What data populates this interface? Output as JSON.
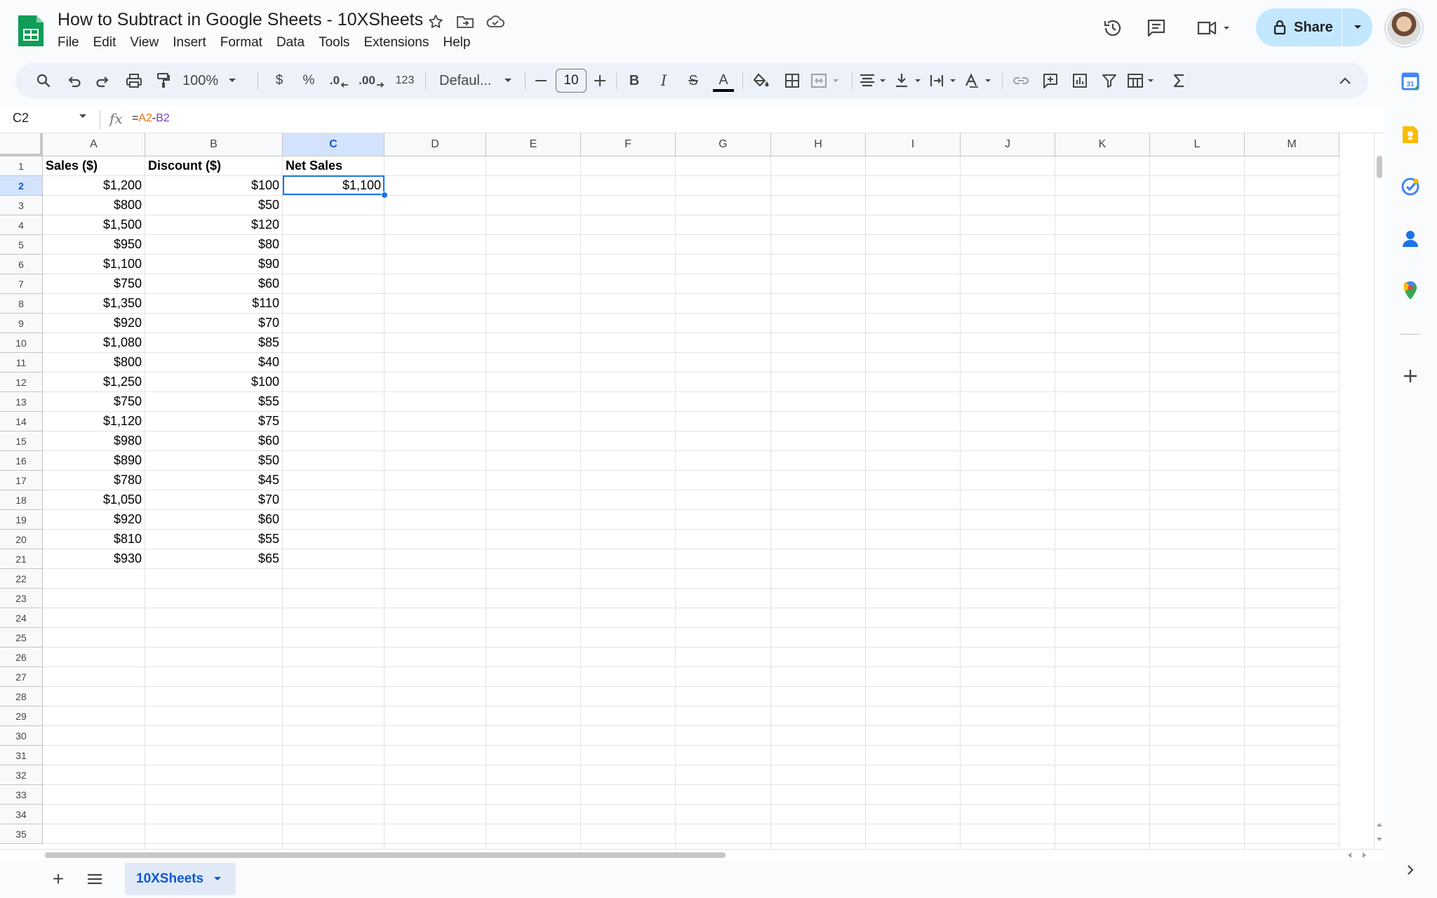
{
  "app": {
    "doc_title": "How to Subtract in Google Sheets - 10XSheets",
    "share_label": "Share"
  },
  "menu": [
    "File",
    "Edit",
    "View",
    "Insert",
    "Format",
    "Data",
    "Tools",
    "Extensions",
    "Help"
  ],
  "toolbar": {
    "zoom": "100%",
    "currency": "$",
    "percent": "%",
    "decrease_decimal": ".0",
    "increase_decimal": ".00",
    "number_format": "123",
    "font": "Defaul...",
    "font_size": "10",
    "bold": "B",
    "italic": "I",
    "strike": "S",
    "text_color": "A"
  },
  "formula_bar": {
    "name_box": "C2",
    "formula_prefix": "=",
    "formula_ref1": "A2",
    "formula_op": "-",
    "formula_ref2": "B2"
  },
  "columns": [
    "A",
    "B",
    "C",
    "D",
    "E",
    "F",
    "G",
    "H",
    "I",
    "J",
    "K",
    "L",
    "M"
  ],
  "selected_column": "C",
  "selected_row": 2,
  "row_count": 35,
  "table": {
    "headers": [
      "Sales ($)",
      "Discount ($)",
      "Net Sales"
    ],
    "rows": [
      [
        "$1,200",
        "$100",
        "$1,100"
      ],
      [
        "$800",
        "$50",
        ""
      ],
      [
        "$1,500",
        "$120",
        ""
      ],
      [
        "$950",
        "$80",
        ""
      ],
      [
        "$1,100",
        "$90",
        ""
      ],
      [
        "$750",
        "$60",
        ""
      ],
      [
        "$1,350",
        "$110",
        ""
      ],
      [
        "$920",
        "$70",
        ""
      ],
      [
        "$1,080",
        "$85",
        ""
      ],
      [
        "$800",
        "$40",
        ""
      ],
      [
        "$1,250",
        "$100",
        ""
      ],
      [
        "$750",
        "$55",
        ""
      ],
      [
        "$1,120",
        "$75",
        ""
      ],
      [
        "$980",
        "$60",
        ""
      ],
      [
        "$890",
        "$50",
        ""
      ],
      [
        "$780",
        "$45",
        ""
      ],
      [
        "$1,050",
        "$70",
        ""
      ],
      [
        "$920",
        "$60",
        ""
      ],
      [
        "$810",
        "$55",
        ""
      ],
      [
        "$930",
        "$65",
        ""
      ]
    ]
  },
  "sheet_tab": "10XSheets",
  "icons": {
    "title": [
      "star-icon",
      "move-folder-icon",
      "cloud-status-icon"
    ],
    "top_right": [
      "version-history-icon",
      "comment-icon",
      "meet-icon"
    ],
    "side_panel": [
      "calendar-icon",
      "keep-icon",
      "tasks-icon",
      "contacts-icon",
      "maps-icon",
      "add-icon"
    ]
  },
  "colors": {
    "accent": "#1a73e8",
    "share_bg": "#c2e7ff",
    "selected_header": "#d3e3fd",
    "formula_ref1": "#e37400",
    "formula_ref2": "#7a3db8"
  }
}
